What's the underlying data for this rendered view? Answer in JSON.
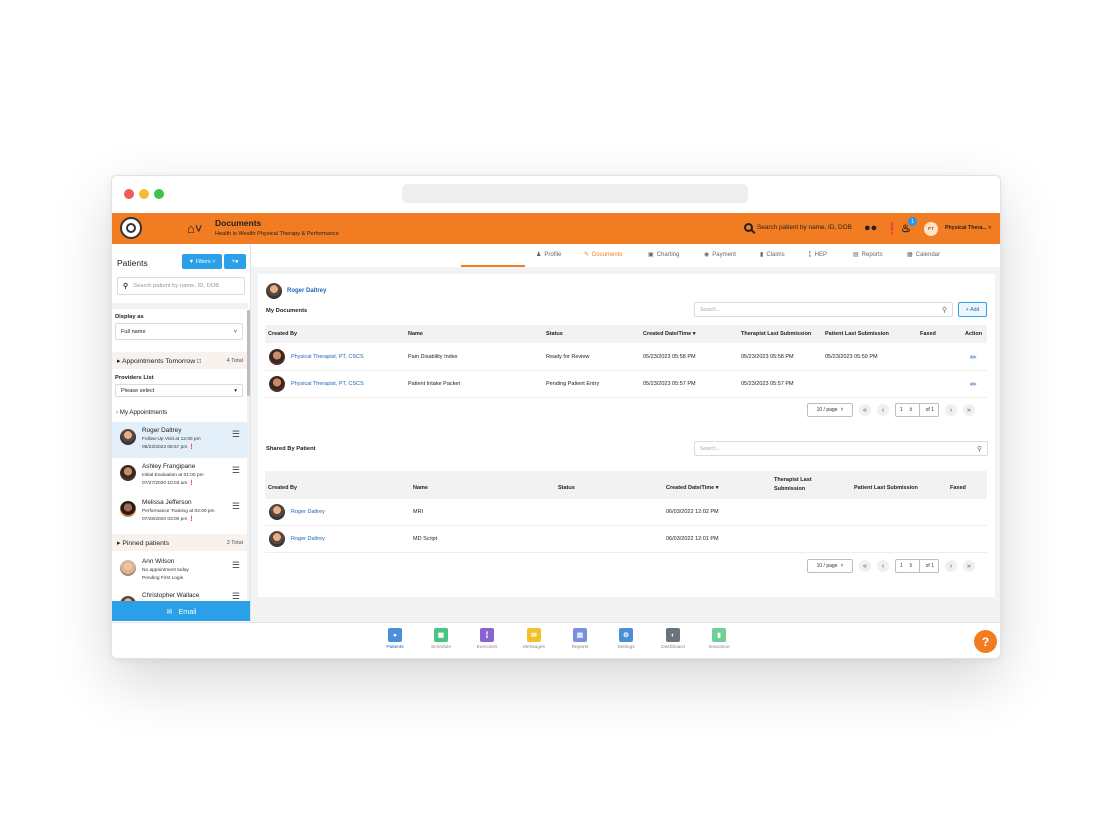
{
  "app": {
    "title": "Documents",
    "subtitle": "Health is Wealth Physical Therapy & Performance",
    "search_placeholder": "Search patient by name, ID, DOB",
    "notification_count": "1",
    "user_initials": "PT",
    "user_name": "Physical Thera...",
    "accent_color": "#f27c21",
    "link_color": "#1c66b8"
  },
  "sidebar": {
    "title": "Patients",
    "filters_label": "Filters",
    "search_placeholder": "Search patient by name, ID, DOB",
    "display_as_label": "Display as",
    "display_as_value": "Full name",
    "appointments_tomorrow_label": "Appointments Tomorrow",
    "appointments_tomorrow_total": "4 Total",
    "providers_label": "Providers List",
    "providers_value": "Please select",
    "my_appointments_label": "My Appointments",
    "appointments": [
      {
        "name": "Roger Daltrey",
        "line1": "Follow-Up Visit at 12:00 pm",
        "line2": "05/23/2023 05:57 pm"
      },
      {
        "name": "Ashley Frangipane",
        "line1": "Initial Evaluation at 01:00 pm",
        "line2": "07/27/2020 10:03 am"
      },
      {
        "name": "Melissa Jefferson",
        "line1": "Performance Training at 02:00 pm",
        "line2": "07/28/2020 03:00 pm"
      }
    ],
    "pinned_label": "Pinned patients",
    "pinned_total": "3 Total",
    "pinned": [
      {
        "name": "Ann Wilson",
        "line1": "No appointment today",
        "line2": "Pending First Login"
      },
      {
        "name": "Christopher Wallace"
      }
    ],
    "email_label": "Email"
  },
  "tabs": [
    "Profile",
    "Documents",
    "Charting",
    "Payment",
    "Claims",
    "HEP",
    "Reports",
    "Calendar"
  ],
  "active_tab": "Documents",
  "patient_name": "Roger Daltrey",
  "my_documents": {
    "title": "My Documents",
    "search_placeholder": "Search...",
    "add_label": "Add",
    "columns": [
      "Created By",
      "Name",
      "Status",
      "Created Date/Time",
      "Therapist Last Submission",
      "Patient Last Submission",
      "Faxed",
      "Action"
    ],
    "rows": [
      {
        "created_by": "Physical Therapist, PT, CSCS",
        "name": "Pain Disability Index",
        "status": "Ready for Review",
        "created": "05/23/2023 05:58 PM",
        "therapist_last": "05/23/2023 05:58 PM",
        "patient_last": "05/23/2023 05:59 PM",
        "faxed": ""
      },
      {
        "created_by": "Physical Therapist, PT, CSCS",
        "name": "Patient Intake Packet",
        "status": "Pending Patient Entry",
        "created": "05/23/2023 05:57 PM",
        "therapist_last": "05/23/2023 05:57 PM",
        "patient_last": "",
        "faxed": ""
      }
    ],
    "pager": {
      "per_page": "10 / page",
      "page": "1",
      "of": "of 1"
    }
  },
  "shared_documents": {
    "title": "Shared By Patient",
    "search_placeholder": "Search...",
    "columns": [
      "Created By",
      "Name",
      "Status",
      "Created Date/Time",
      "Therapist Last Submission",
      "Patient Last Submission",
      "Faxed"
    ],
    "rows": [
      {
        "created_by": "Roger Daltrey",
        "name": "MRI",
        "status": "",
        "created": "06/03/2022 12:02 PM"
      },
      {
        "created_by": "Roger Daltrey",
        "name": "MD Script",
        "status": "",
        "created": "06/03/2022 12:01 PM"
      }
    ],
    "pager": {
      "per_page": "10 / page",
      "page": "1",
      "of": "of 1"
    }
  },
  "bottom_nav": [
    {
      "label": "Patients",
      "icon": "patients-icon",
      "color": "#4a8fd8"
    },
    {
      "label": "Schedule",
      "icon": "schedule-icon",
      "color": "#4cc184"
    },
    {
      "label": "Exercises",
      "icon": "exercises-icon",
      "color": "#8a63d2"
    },
    {
      "label": "Messages",
      "icon": "messages-icon",
      "color": "#f2c12e"
    },
    {
      "label": "Reports",
      "icon": "reports-icon",
      "color": "#7b8fe0"
    },
    {
      "label": "Settings",
      "icon": "settings-icon",
      "color": "#4a8fd8"
    },
    {
      "label": "Dashboard",
      "icon": "dashboard-icon",
      "color": "#6b7280"
    },
    {
      "label": "Insurance",
      "icon": "insurance-icon",
      "color": "#6fcf97"
    }
  ],
  "help_label": "?"
}
